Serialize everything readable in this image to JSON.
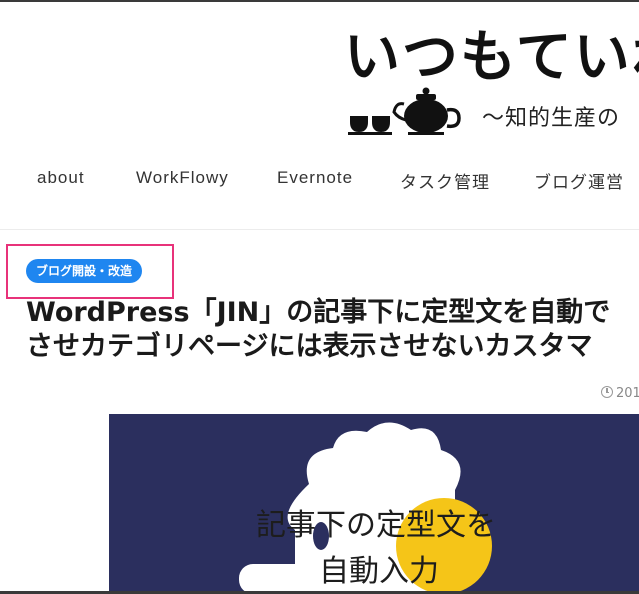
{
  "site": {
    "logo_title": "いつもていね",
    "logo_subtitle": "〜知的生産の"
  },
  "nav": {
    "items": [
      {
        "label": "about"
      },
      {
        "label": "WorkFlowy"
      },
      {
        "label": "Evernote"
      },
      {
        "label": "タスク管理"
      },
      {
        "label": "ブログ運営"
      }
    ]
  },
  "post": {
    "category": "ブログ開設・改造",
    "title_line1": "WordPress「JIN」の記事下に定型文を自動で",
    "title_line2": "させカテゴリページには表示させないカスタマ",
    "date": "201",
    "hero": {
      "line1": "記事下の定型文を",
      "line2": "自動入力"
    }
  },
  "colors": {
    "badge": "#1f86f0",
    "highlight": "#e8327a",
    "hero_bg": "#2b2f5e",
    "hero_accent": "#f5c518"
  }
}
